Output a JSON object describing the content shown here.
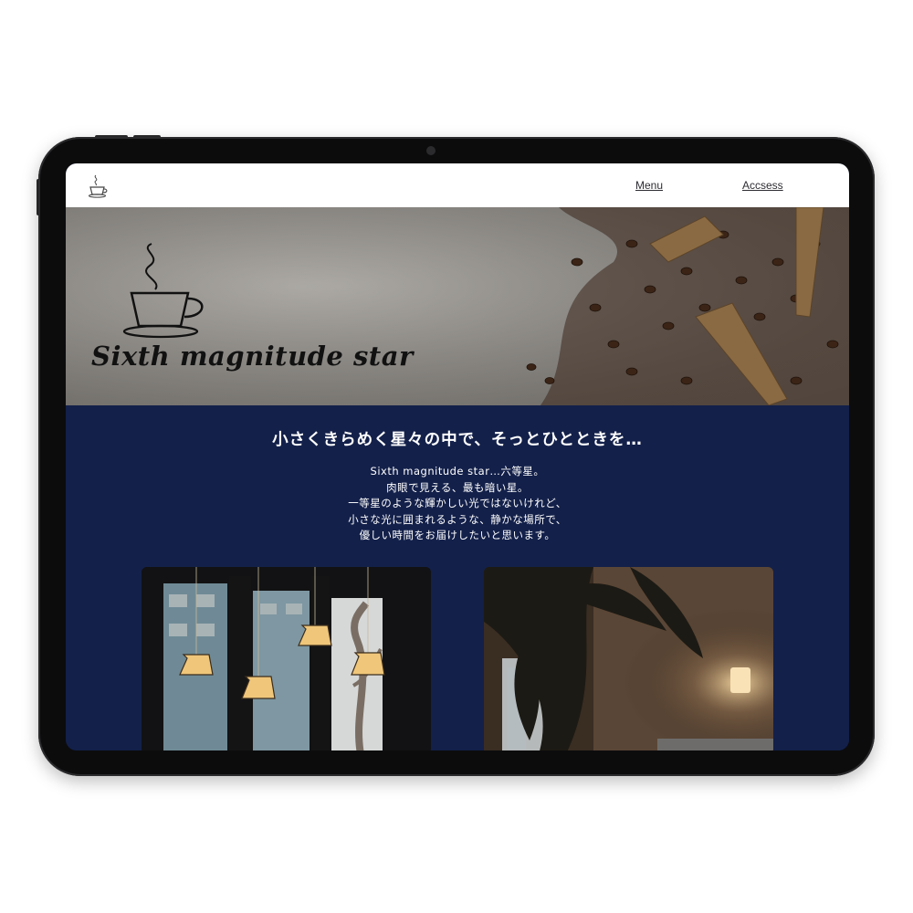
{
  "device": {
    "type": "tablet",
    "frame_color": "#0c0c0d"
  },
  "nav": {
    "logo_icon": "coffee-cup-icon",
    "links": [
      {
        "label": "Menu"
      },
      {
        "label": "Accsess"
      }
    ]
  },
  "hero": {
    "title": "Sixth magnitude star",
    "logo_icon": "coffee-cup-icon",
    "background_image": "coffee-beans-on-concrete"
  },
  "main": {
    "headline": "小さくきらめく星々の中で、そっとひとときを…",
    "body_lines": [
      "Sixth magnitude star…六等星。",
      "肉眼で見える、最も暗い星。",
      "一等星のような輝かしい光ではないけれど、",
      "小さな光に囲まれるような、静かな場所で、",
      "優しい時間をお届けしたいと思います。"
    ],
    "photos": [
      {
        "subject": "cafe-window-pendant-lamps"
      },
      {
        "subject": "cafe-wall-lamp-plant"
      }
    ]
  },
  "colors": {
    "background_navy": "#13204a",
    "nav_background": "#ffffff",
    "text_light": "#ffffff",
    "text_dark": "#111111"
  }
}
